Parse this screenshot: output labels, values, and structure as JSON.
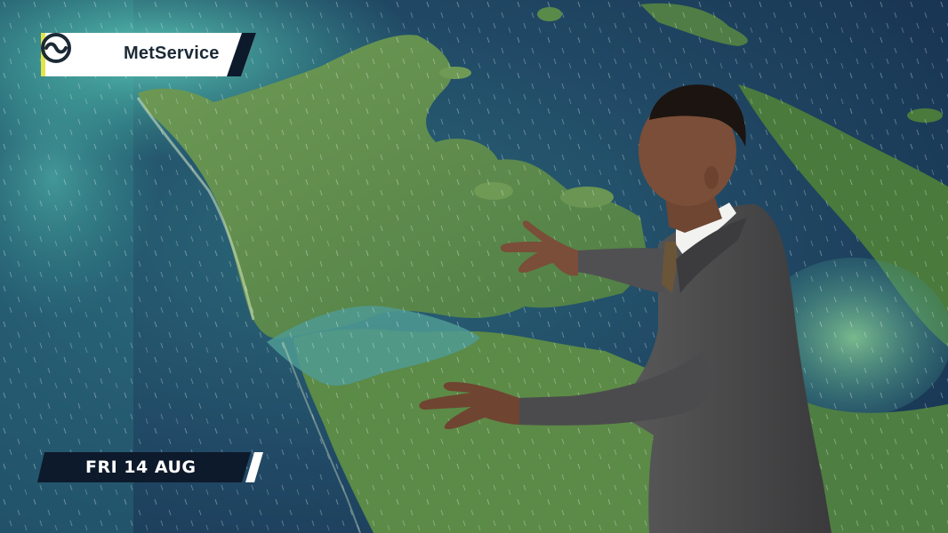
{
  "overlay": {
    "brand": {
      "name": "MetService",
      "icon": "metservice-swirl-icon"
    },
    "date_label": "FRI 14 AUG"
  },
  "colors": {
    "badge_white": "#ffffff",
    "badge_navy": "#0d1a2b",
    "accent_yellow": "#e3e44a",
    "sea_deep": "#1c3956",
    "sea_teal": "#3fa99a",
    "land_green": "#5e8c4a",
    "suit_gray": "#4a4a4b"
  },
  "scene": {
    "description_icon": "weather-map-icon",
    "presenter_icon": "person-icon"
  }
}
